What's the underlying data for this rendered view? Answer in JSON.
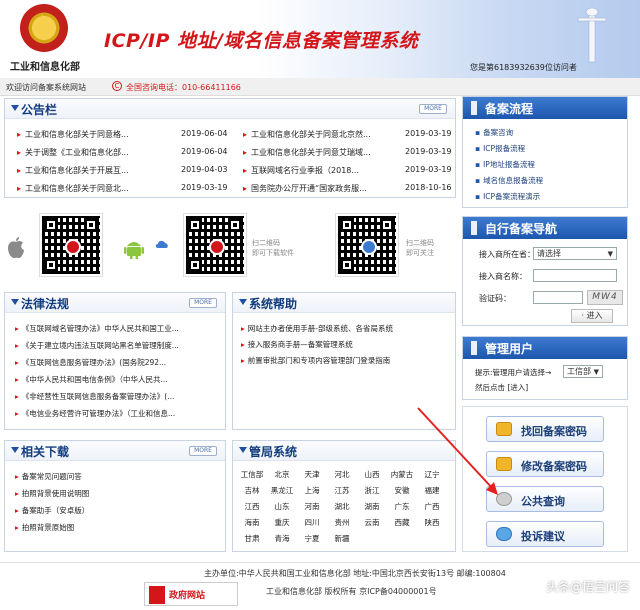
{
  "header": {
    "ministry_name": "工业和信息化部",
    "system_title": "ICP/IP 地址/域名信息备案管理系统",
    "visitor_text": "您是第6183932639位访问者"
  },
  "topbar": {
    "welcome": "欢迎访问备案系统网站",
    "hotline": "全国咨询电话：010-66411166"
  },
  "notice": {
    "title": "公告栏",
    "more": "MORE",
    "left": [
      {
        "text": "工业和信息化部关于同意格...",
        "date": "2019-06-04"
      },
      {
        "text": "关于调整《工业和信息化部...",
        "date": "2019-06-04"
      },
      {
        "text": "工业和信息化部关于开展互...",
        "date": "2019-04-03"
      },
      {
        "text": "工业和信息化部关于同意北...",
        "date": "2019-03-19"
      }
    ],
    "right": [
      {
        "text": "工业和信息化部关于同意北京然...",
        "date": "2019-03-19"
      },
      {
        "text": "工业和信息化部关于同意艾瑞域...",
        "date": "2019-03-19"
      },
      {
        "text": "互联网域名行业季报（2018...",
        "date": "2019-03-19"
      },
      {
        "text": "国务院办公厅开通“国家政务服...",
        "date": "2018-10-16"
      }
    ]
  },
  "qr": {
    "caption1": "扫二维码\n即可下载软件",
    "caption2": "扫二维码\n即可关注"
  },
  "laws": {
    "title": "法律法规",
    "more": "MORE",
    "items": [
      "《互联网域名管理办法》中华人民共和国工业...",
      "《关于建立境内违法互联网站黑名单管理制度...",
      "《互联网信息服务管理办法》(国务院292...",
      "《中华人民共和国电信条例》（中华人民共...",
      "《非经营性互联网信息服务备案管理办法》(...",
      "《电信业务经营许可管理办法》（工业和信息..."
    ]
  },
  "help": {
    "title": "系统帮助",
    "items": [
      "网站主办者使用手册-部级系统、各省局系统",
      "接入服务商手册—备案管理系统",
      "前置审批部门和专项内容管理部门登录指南"
    ]
  },
  "downloads": {
    "title": "相关下载",
    "more": "MORE",
    "items": [
      "备案常见问题问答",
      "拍照背景使用说明图",
      "备案助手（安卓版）",
      "拍照背景原始图"
    ]
  },
  "bureau": {
    "title": "管局系统",
    "provinces": [
      "工信部",
      "北京",
      "天津",
      "河北",
      "山西",
      "内蒙古",
      "辽宁",
      "吉林",
      "黑龙江",
      "上海",
      "江苏",
      "浙江",
      "安徽",
      "福建",
      "江西",
      "山东",
      "河南",
      "湖北",
      "湖南",
      "广东",
      "广西",
      "海南",
      "重庆",
      "四川",
      "贵州",
      "云南",
      "西藏",
      "陕西",
      "甘肃",
      "青海",
      "宁夏",
      "新疆"
    ]
  },
  "sidebar": {
    "flow": {
      "title": "备案流程",
      "items": [
        "备案咨询",
        "ICP报备流程",
        "IP地址报备流程",
        "域名信息报备流程",
        "ICP备案流程演示"
      ]
    },
    "guide": {
      "title": "自行备案导航",
      "isp_location_label": "接入商所在省：",
      "isp_location_value": "请选择",
      "isp_name_label": "接入商名称：",
      "captcha_label": "验证码：",
      "captcha_text": "MW4",
      "go_label": "进入"
    },
    "admin": {
      "title": "管理用户",
      "prompt": "提示:管理用户请选择→",
      "select_value": "工信部",
      "tail": "然后点击 [进入]"
    },
    "actions": [
      "找回备案密码",
      "修改备案密码",
      "公共查询",
      "投诉建议"
    ]
  },
  "footer": {
    "line1": "主办单位:中华人民共和国工业和信息化部 地址:中国北京西长安街13号 邮编:100804",
    "line2": "工业和信息化部 版权所有 京ICP备04000001号",
    "gov_badge": "政府网站",
    "watermark": "头条@悟空问答"
  },
  "colors": {
    "title_red": "#d4161b",
    "nav_blue": "#1d57ad",
    "heading_blue": "#123d80"
  }
}
